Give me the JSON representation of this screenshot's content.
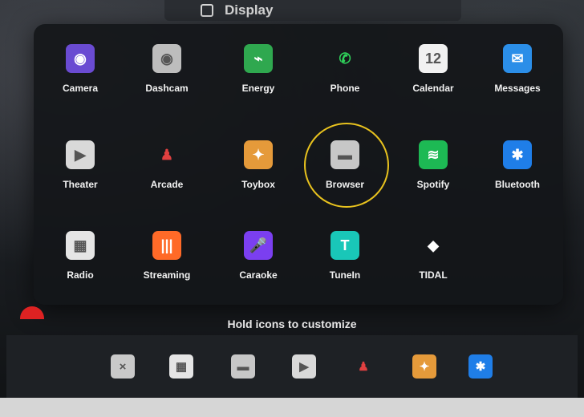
{
  "header": {
    "title": "Display"
  },
  "apps": [
    {
      "label": "Camera",
      "icon": "camera-icon",
      "glyph": "◉",
      "bg": "#6a4bd2"
    },
    {
      "label": "Dashcam",
      "icon": "dashcam-icon",
      "glyph": "◉",
      "bg": "#bdbdbd"
    },
    {
      "label": "Energy",
      "icon": "energy-icon",
      "glyph": "⌁",
      "bg": "#2fa84f"
    },
    {
      "label": "Phone",
      "icon": "phone-icon",
      "glyph": "✆",
      "bg": "transparent"
    },
    {
      "label": "Calendar",
      "icon": "calendar-icon",
      "glyph": "12",
      "bg": "#f1f1f1"
    },
    {
      "label": "Messages",
      "icon": "messages-icon",
      "glyph": "✉",
      "bg": "#2b8ee8"
    },
    {
      "label": "Theater",
      "icon": "theater-icon",
      "glyph": "▶",
      "bg": "#d9d9d9"
    },
    {
      "label": "Arcade",
      "icon": "arcade-icon",
      "glyph": "♟",
      "bg": "transparent"
    },
    {
      "label": "Toybox",
      "icon": "toybox-icon",
      "glyph": "✦",
      "bg": "#e59a3a"
    },
    {
      "label": "Browser",
      "icon": "browser-icon",
      "glyph": "▬",
      "bg": "#c7c7c7"
    },
    {
      "label": "Spotify",
      "icon": "spotify-icon",
      "glyph": "≋",
      "bg": "#1db954"
    },
    {
      "label": "Bluetooth",
      "icon": "bluetooth-icon",
      "glyph": "✱",
      "bg": "#1f7ee8"
    },
    {
      "label": "Radio",
      "icon": "radio-icon",
      "glyph": "▦",
      "bg": "#e5e5e5"
    },
    {
      "label": "Streaming",
      "icon": "streaming-icon",
      "glyph": "|||",
      "bg": "#ff6a28"
    },
    {
      "label": "Caraoke",
      "icon": "caraoke-icon",
      "glyph": "🎤",
      "bg": "#7b3ff0"
    },
    {
      "label": "TuneIn",
      "icon": "tunein-icon",
      "glyph": "T",
      "bg": "#19c7b8"
    },
    {
      "label": "TIDAL",
      "icon": "tidal-icon",
      "glyph": "◆",
      "bg": "transparent"
    }
  ],
  "dock": {
    "hint": "Hold icons to customize",
    "items": [
      {
        "icon": "close-icon",
        "glyph": "×",
        "bg": "#c9c9c9"
      },
      {
        "icon": "radio-icon",
        "glyph": "▦",
        "bg": "#e5e5e5"
      },
      {
        "icon": "browser-icon",
        "glyph": "▬",
        "bg": "#c7c7c7"
      },
      {
        "icon": "theater-icon",
        "glyph": "▶",
        "bg": "#d9d9d9"
      },
      {
        "icon": "arcade-icon",
        "glyph": "♟",
        "bg": "transparent"
      },
      {
        "icon": "toybox-icon",
        "glyph": "✦",
        "bg": "#e59a3a"
      },
      {
        "icon": "bluetooth-icon",
        "glyph": "✱",
        "bg": "#1f7ee8"
      }
    ]
  },
  "colors": {
    "highlight": "#e8c21e",
    "accent_red": "#dd2222"
  }
}
